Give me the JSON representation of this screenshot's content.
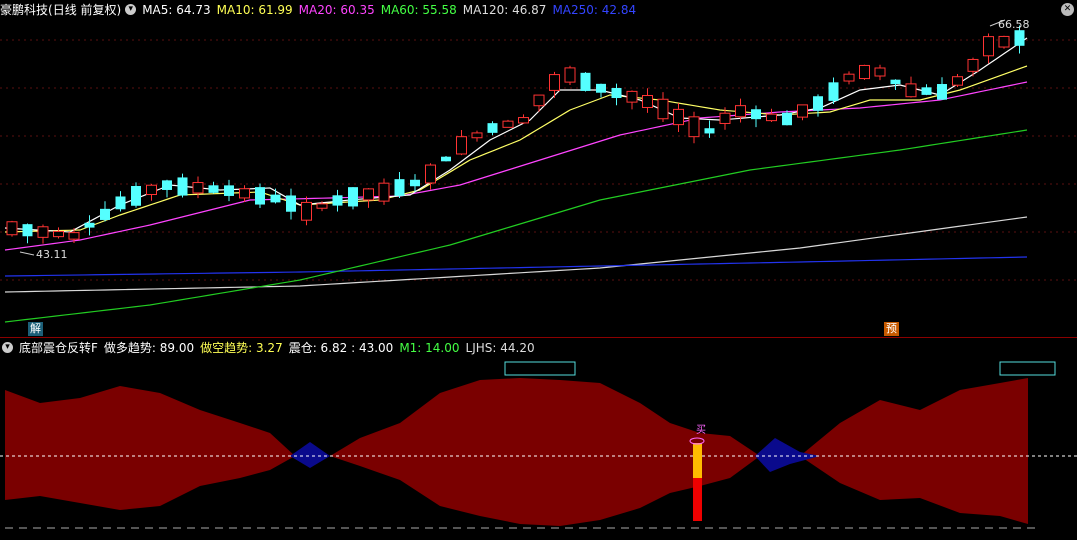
{
  "header": {
    "stock_name": "豪鹏科技",
    "period": "(日线 前复权)",
    "ma": [
      {
        "label": "MA5: 64.73",
        "color": "#ffffff"
      },
      {
        "label": "MA10: 61.99",
        "color": "#ffff55"
      },
      {
        "label": "MA20: 60.35",
        "color": "#ff44ff"
      },
      {
        "label": "MA60: 55.58",
        "color": "#44ff44"
      },
      {
        "label": "MA120: 46.87",
        "color": "#dddddd"
      },
      {
        "label": "MA250: 42.84",
        "color": "#3344ff"
      }
    ]
  },
  "main_chart": {
    "high_label": "66.58",
    "low_label": "43.11",
    "marker_left": "解",
    "marker_right": "预"
  },
  "sub_chart": {
    "indicator_name": "底部震仓反转F",
    "values": [
      {
        "label": "做多趋势: 89.00",
        "color": "#ffffff"
      },
      {
        "label": "做空趋势: 3.27",
        "color": "#ffff55"
      },
      {
        "label": "震仓: 6.82 : 43.00",
        "color": "#ffffff"
      },
      {
        "label": "M1: 14.00",
        "color": "#44ff44"
      },
      {
        "label": "LJHS: 44.20",
        "color": "#dddddd"
      }
    ],
    "buy_label": "买"
  },
  "colors": {
    "up": "#ff3333",
    "down": "#55ffff",
    "area_red": "#7a0000",
    "area_blue": "#0a0a8c"
  }
}
